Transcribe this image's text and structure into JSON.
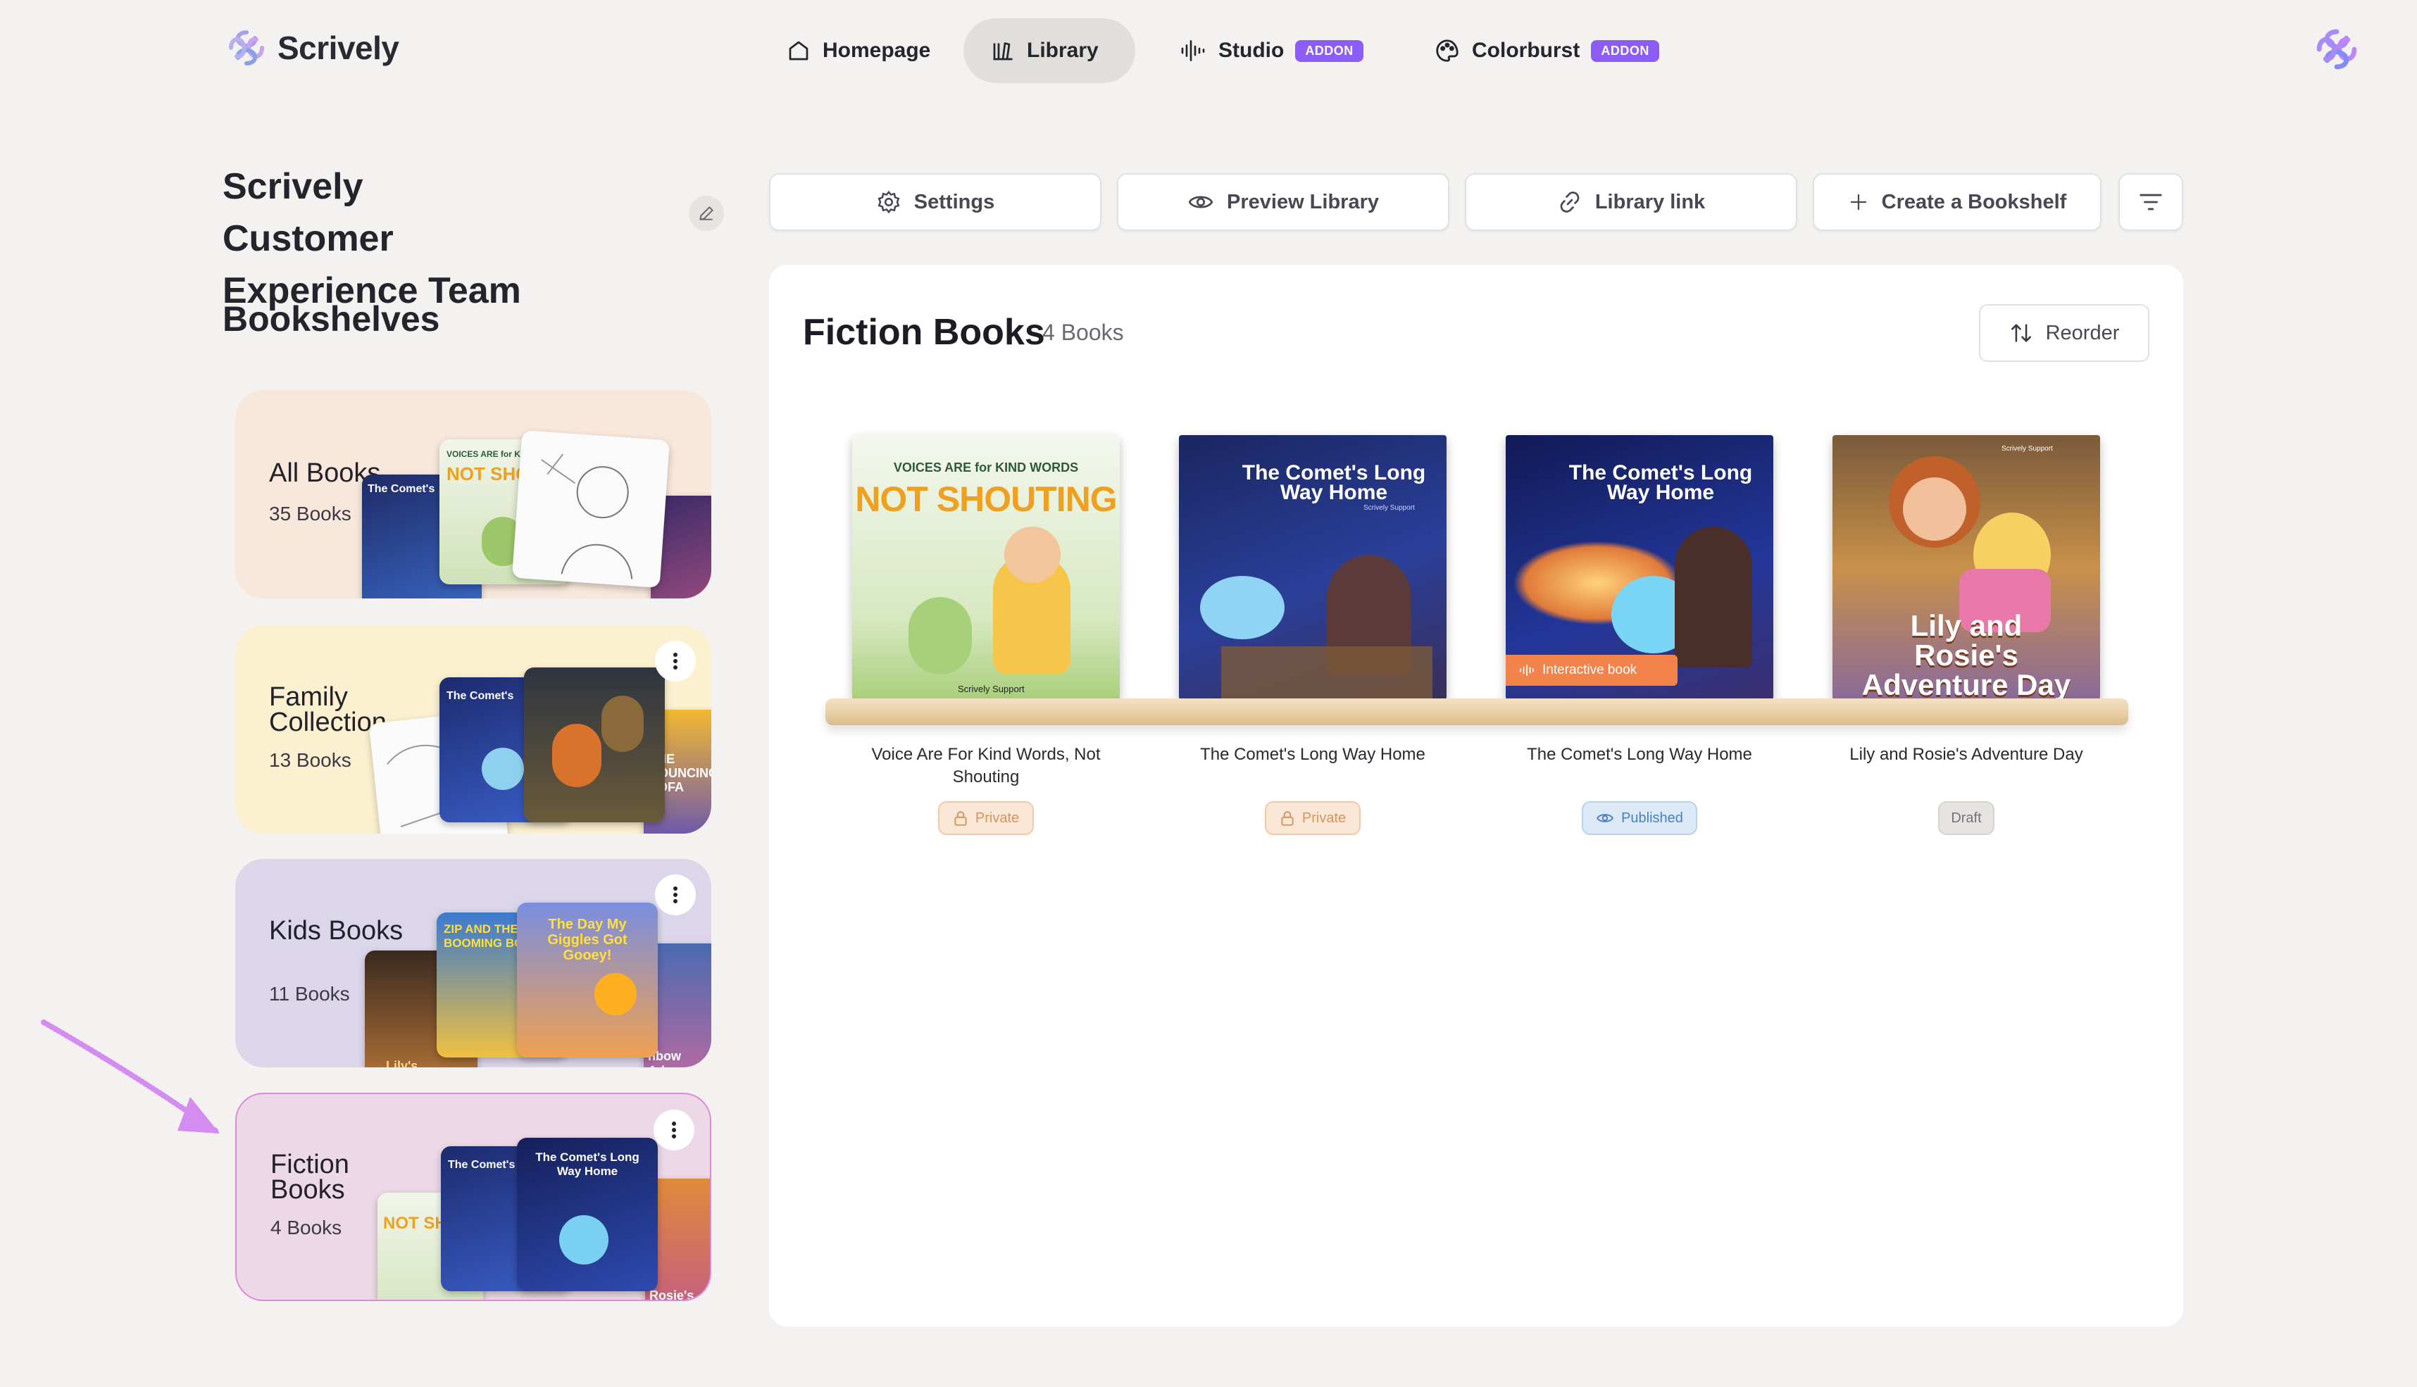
{
  "app": {
    "brand": "Scrively"
  },
  "nav": {
    "items": [
      {
        "label": "Homepage",
        "icon": "home-icon",
        "active": false
      },
      {
        "label": "Library",
        "icon": "library-icon",
        "active": true
      },
      {
        "label": "Studio",
        "icon": "audio-wave-icon",
        "badge": "ADDON"
      },
      {
        "label": "Colorburst",
        "icon": "palette-icon",
        "badge": "ADDON"
      }
    ]
  },
  "sidebar": {
    "team_name": "Scrively Customer Experience Team",
    "bookshelves_heading": "Bookshelves",
    "shelves": [
      {
        "name": "All Books",
        "count": "35 Books",
        "bg": "#f8e7db"
      },
      {
        "name": "Family Collection",
        "count": "13 Books",
        "bg": "#fbf0cf"
      },
      {
        "name": "Kids Books",
        "count": "11 Books",
        "bg": "#dcd6ea"
      },
      {
        "name": "Fiction Books",
        "count": "4 Books",
        "bg": "#ecd8e6",
        "selected": true
      }
    ]
  },
  "toolbar": {
    "settings": "Settings",
    "preview": "Preview Library",
    "link": "Library link",
    "create": "Create a Bookshelf"
  },
  "panel": {
    "title": "Fiction Books",
    "count": "4 Books",
    "reorder": "Reorder",
    "books": [
      {
        "title": "Voice Are For Kind Words, Not Shouting",
        "status": "Private",
        "cover_top": "VOICES ARE for KIND WORDS",
        "cover_main": "NOT SHOUTING",
        "cover_author": "Scrively Support"
      },
      {
        "title": "The Comet's Long Way Home",
        "status": "Private",
        "cover_main": "The Comet's Long Way Home",
        "cover_author": "Scrively Support"
      },
      {
        "title": "The Comet's Long Way Home",
        "status": "Published",
        "cover_main": "The Comet's Long Way Home",
        "tag": "Interactive book"
      },
      {
        "title": "Lily and Rosie's Adventure Day",
        "status": "Draft",
        "cover_main": "Lily and Rosie's Adventure Day",
        "cover_author": "Scrively Support"
      }
    ]
  },
  "thumbs": {
    "not_shouting": "NOT SHO",
    "voices": "VOICES ARE for K",
    "comet": "The Comet's",
    "comet_long": "The Comet's Long Way Home",
    "zip": "ZIP AND THE BOOMING BO",
    "giggles": "The Day My Giggles Got Gooey!",
    "bouncing": "THE BOUNCING SOFA",
    "lily": "Lily's Adventure",
    "rainbow": "nbow Advent",
    "rosie": "Rosie's venture D",
    "not_sh": "NOT SH"
  },
  "colors": {
    "accent": "#8b5cf6",
    "arrow": "#d48cf0"
  }
}
